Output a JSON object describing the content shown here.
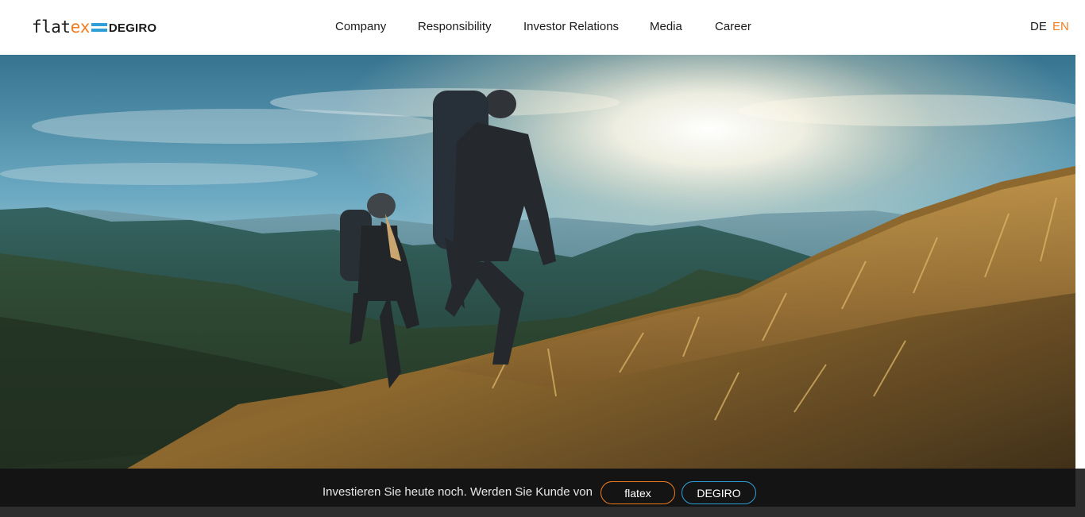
{
  "header": {
    "logo": {
      "part1": "flat",
      "part2": "ex",
      "part3": "DEGIRO"
    },
    "nav": [
      {
        "label": "Company"
      },
      {
        "label": "Responsibility"
      },
      {
        "label": "Investor Relations"
      },
      {
        "label": "Media"
      },
      {
        "label": "Career"
      }
    ],
    "languages": {
      "de": "DE",
      "en": "EN",
      "active": "EN"
    }
  },
  "hero": {
    "image": "hikers-mountain-ridge-sunrise"
  },
  "cta": {
    "text": "Investieren Sie heute noch. Werden Sie Kunde von",
    "flatex_button": "flatex",
    "degiro_button": "DEGIRO"
  },
  "colors": {
    "accent_orange": "#f07c1e",
    "accent_blue": "#2f9fd8",
    "cta_bar": "#141414"
  }
}
